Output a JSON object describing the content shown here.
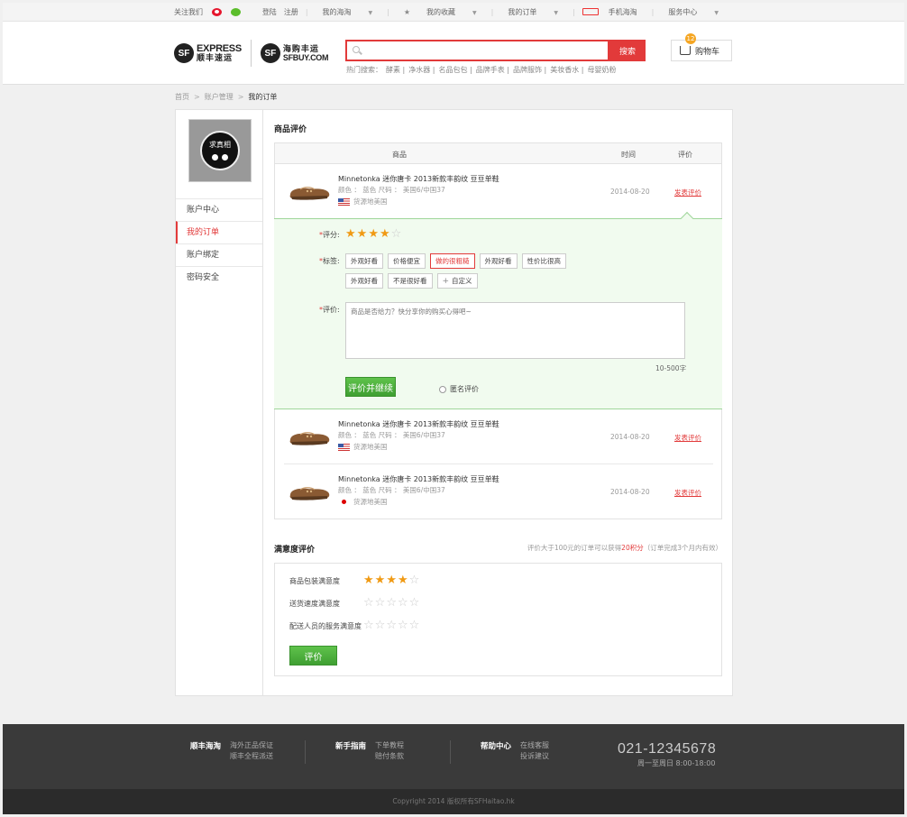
{
  "topbar": {
    "follow": "关注我们",
    "login": "登陆",
    "register": "注册",
    "my_haitao": "我的海淘",
    "favorites": "我的收藏",
    "orders": "我的订单",
    "mobile": "手机海淘",
    "service": "服务中心"
  },
  "logo": {
    "sf": "SF",
    "express": "EXPRESS",
    "express_cn": "顺丰速运",
    "sfbuy_cn": "海购丰运",
    "sfbuy": "SFBUY.COM"
  },
  "search": {
    "placeholder": "",
    "button": "搜索",
    "hot_label": "热门搜索：",
    "hot": [
      "酵素 |",
      "净水器 |",
      "名品包包 |",
      "品牌手表 |",
      "品牌服饰 |",
      "美妆香水 |",
      "母婴奶粉"
    ]
  },
  "cart": {
    "label": "购物车",
    "count": "12"
  },
  "breadcrumb": {
    "home": "首页",
    "account": "账户管理",
    "current": "我的订单"
  },
  "sidebar": {
    "avatar_text": "求真相",
    "items": [
      {
        "label": "账户中心"
      },
      {
        "label": "我的订单"
      },
      {
        "label": "账户绑定"
      },
      {
        "label": "密码安全"
      }
    ]
  },
  "review": {
    "title": "商品评价",
    "col_product": "商品",
    "col_time": "时间",
    "col_review": "评价",
    "products": [
      {
        "name": "Minnetonka 迷你唐卡 2013新款丰韵纹 豆豆单鞋",
        "attrs": "颜色 ： 蓝色   尺码 ： 美国6/中国37",
        "origin": "货源地美国",
        "date": "2014-08-20",
        "action": "发表评价"
      },
      {
        "name": "Minnetonka 迷你唐卡 2013新款丰韵纹 豆豆单鞋",
        "attrs": "颜色 ： 蓝色   尺码 ： 美国6/中国37",
        "origin": "货源地美国",
        "date": "2014-08-20",
        "action": "发表评价"
      },
      {
        "name": "Minnetonka 迷你唐卡 2013新款丰韵纹 豆豆单鞋",
        "attrs": "颜色 ： 蓝色   尺码 ： 美国6/中国37",
        "origin": "货源地美国",
        "date": "2014-08-20",
        "action": "发表评价"
      }
    ],
    "score_label": "评分:",
    "score": 4,
    "score_max": 5,
    "tags_label": "标签:",
    "tags": [
      {
        "label": "外观好看",
        "selected": false
      },
      {
        "label": "价格便宜",
        "selected": false
      },
      {
        "label": "做的很粗糙",
        "selected": true
      },
      {
        "label": "外观好看",
        "selected": false
      },
      {
        "label": "性价比很高",
        "selected": false
      },
      {
        "label": "外观好看",
        "selected": false
      },
      {
        "label": "不是很好看",
        "selected": false
      }
    ],
    "custom_tag": "自定义",
    "comment_label": "评价:",
    "comment_placeholder": "商品是否给力？快分享你的购买心得吧~",
    "count_hint": "10-500字",
    "submit": "评价并继续",
    "anonymous": "匿名评价"
  },
  "satisfaction": {
    "title": "满意度评价",
    "note_pre": "评价大于100元的订单可以获得",
    "note_points": "20积分",
    "note_post": "（订单完成3个月内有效）",
    "items": [
      {
        "label": "商品包装满意度",
        "score": 4
      },
      {
        "label": "送货速度满意度",
        "score": 0
      },
      {
        "label": "配送人员的服务满意度",
        "score": 0
      }
    ],
    "submit": "评价"
  },
  "footer": {
    "col1_title": "顺丰海淘",
    "col1_links": [
      "海外正品保证",
      "顺丰全程派送"
    ],
    "col2_title": "新手指南",
    "col2_links": [
      "下单教程",
      "赔付条款"
    ],
    "col3_title": "帮助中心",
    "col3_links": [
      "在线客服",
      "投诉建议"
    ],
    "phone": "021-12345678",
    "hours": "周一至周日 8:00-18:00",
    "copyright": "Copyright 2014 版权所有SFHaitao.hk"
  },
  "colors": {
    "accent": "#e23a3a",
    "green": "#4cae3d",
    "star": "#f09a14"
  }
}
